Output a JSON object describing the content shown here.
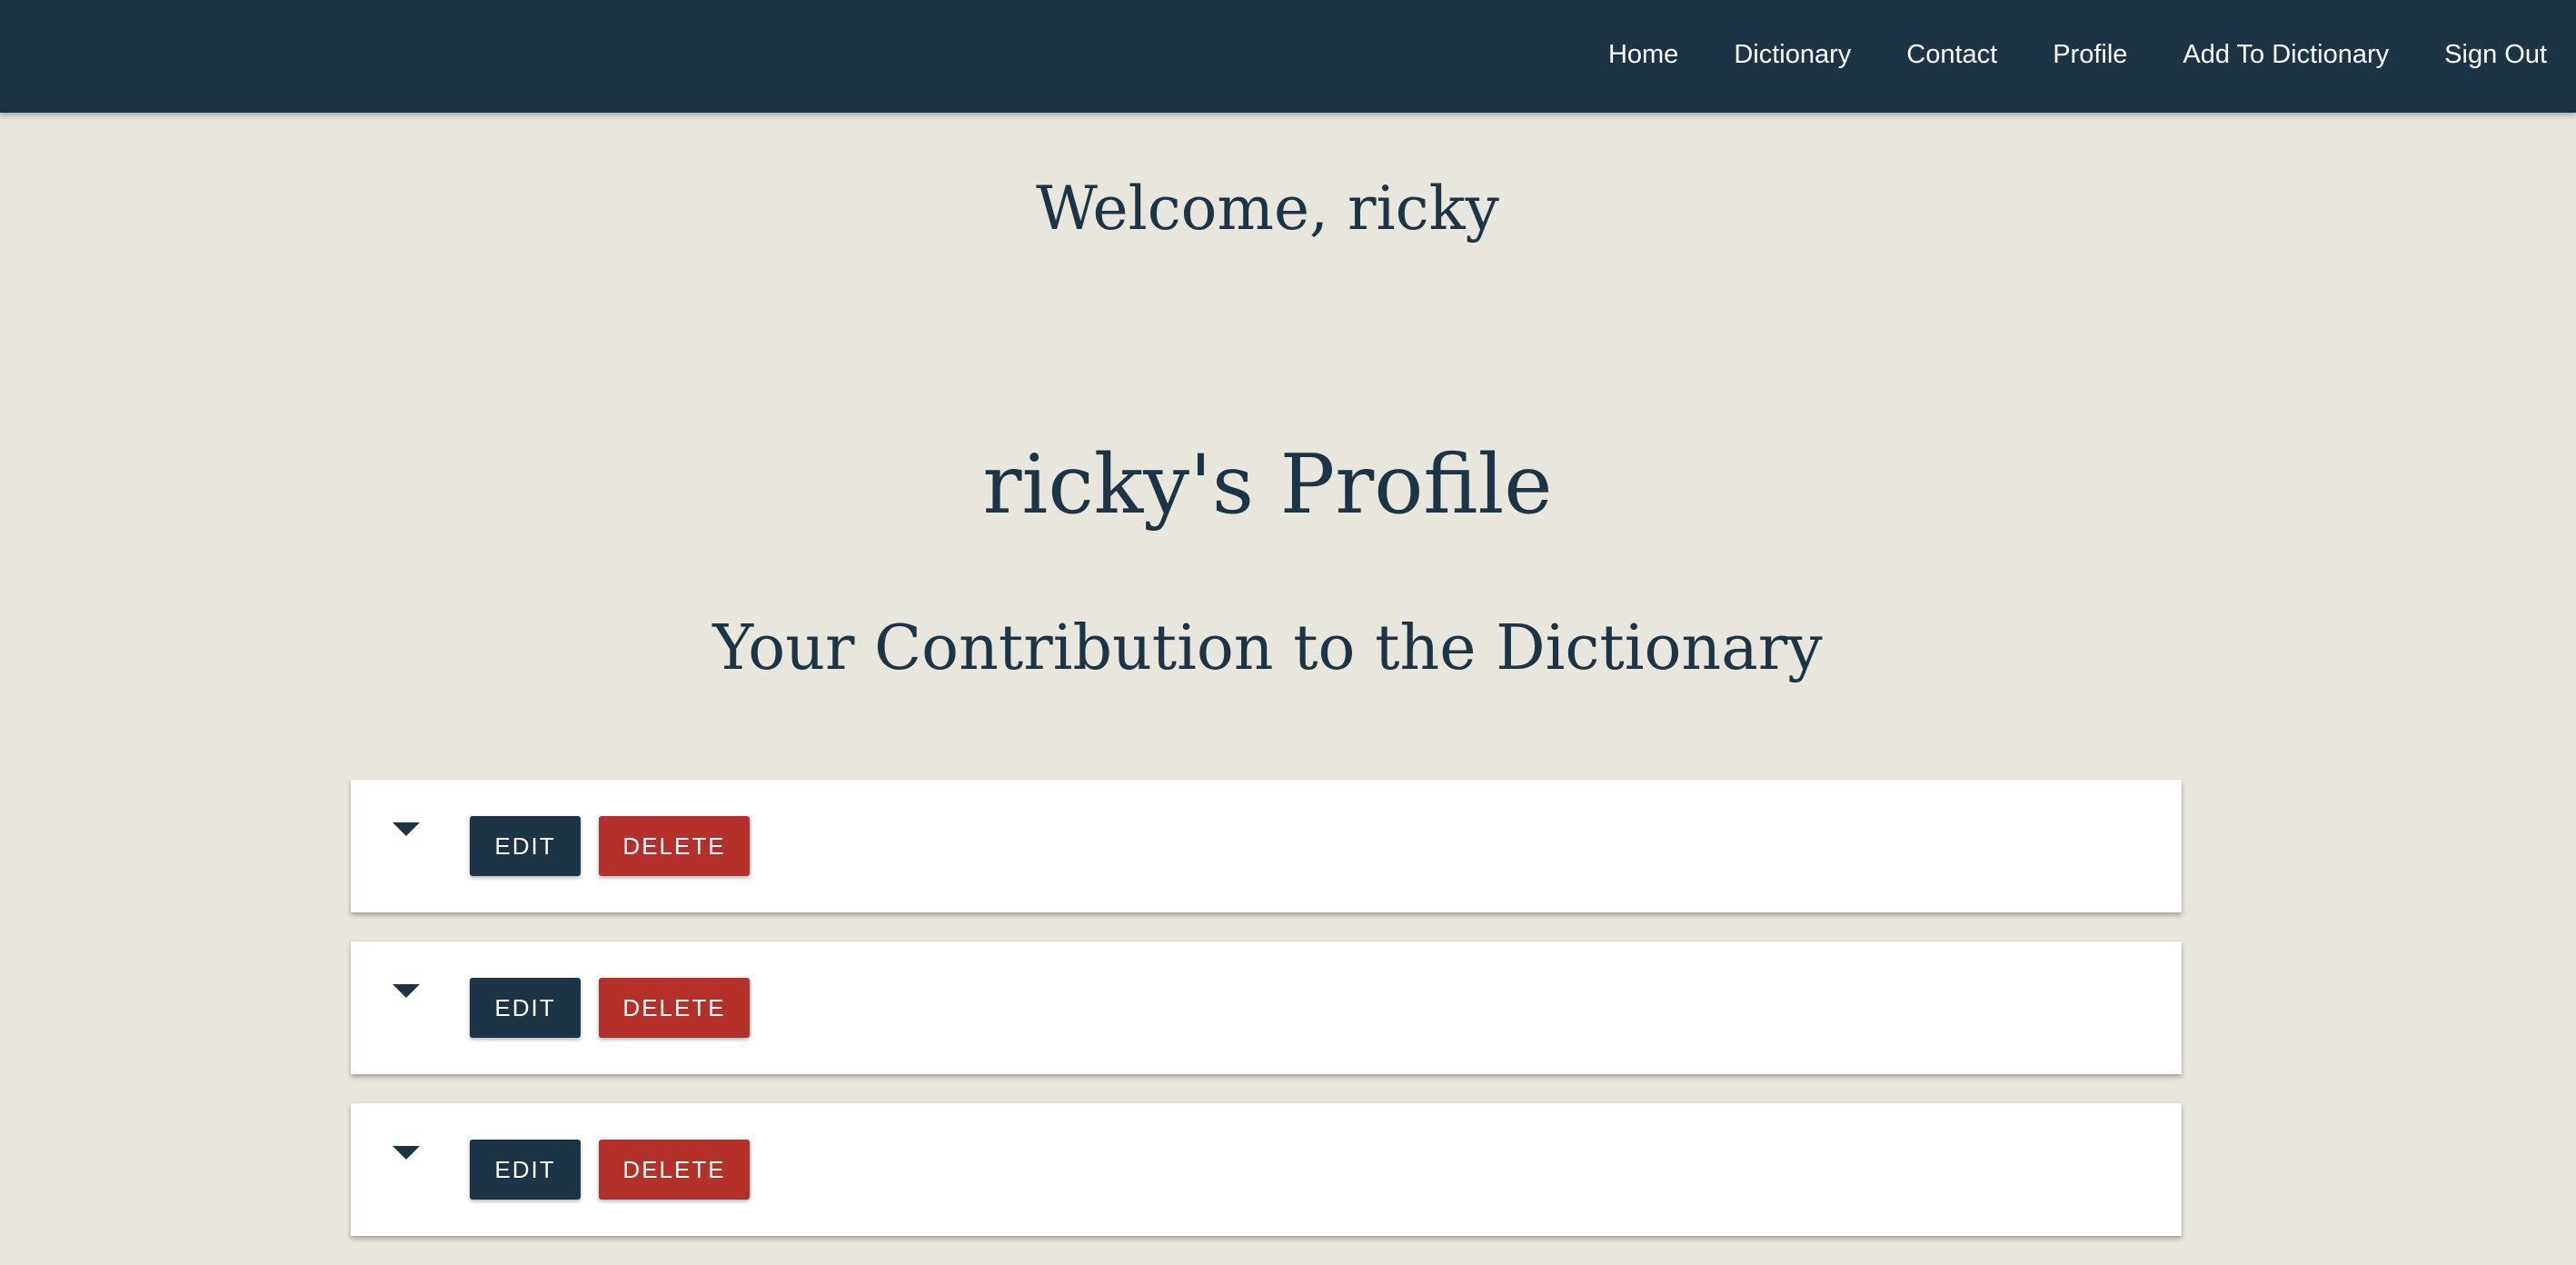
{
  "nav": {
    "links": [
      "Home",
      "Dictionary",
      "Contact",
      "Profile",
      "Add To Dictionary",
      "Sign Out"
    ]
  },
  "welcome": "Welcome, ricky",
  "profile_title": "ricky's Profile",
  "contribution_title": "Your Contribution to the Dictionary",
  "entries": [
    {
      "edit_label": "EDIT",
      "delete_label": "DELETE",
      "toggle_icon": "caret-down-icon"
    },
    {
      "edit_label": "EDIT",
      "delete_label": "DELETE",
      "toggle_icon": "caret-down-icon"
    },
    {
      "edit_label": "EDIT",
      "delete_label": "DELETE",
      "toggle_icon": "caret-down-icon"
    }
  ],
  "colors": {
    "navbar": "#1b3546",
    "background": "#e9e6dd",
    "primary": "#1b3546",
    "danger": "#b3302b"
  }
}
